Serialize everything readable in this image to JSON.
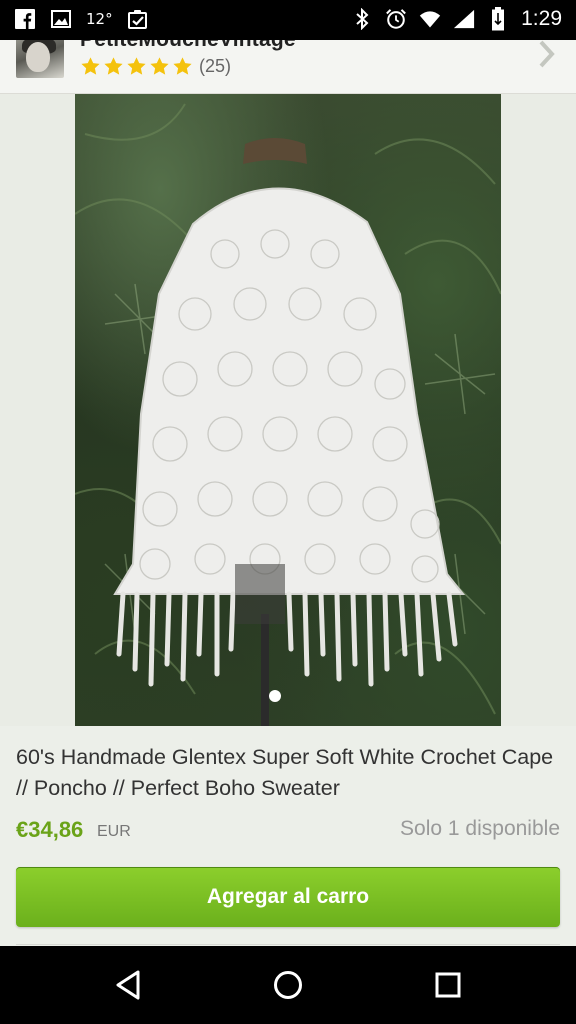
{
  "status_bar": {
    "temperature": "12°",
    "time": "1:29",
    "icons": [
      "facebook-icon",
      "image-icon",
      "checklist-icon",
      "bluetooth-icon",
      "alarm-icon",
      "wifi-icon",
      "signal-icon",
      "battery-icon"
    ]
  },
  "shop": {
    "name": "PetiteMoucheVintage",
    "rating_stars": 5,
    "review_count": "(25)"
  },
  "gallery": {
    "image_count_dots": 1,
    "active_index": 0
  },
  "listing": {
    "title": "60's Handmade Glentex Super Soft White Crochet Cape // Poncho // Perfect Boho Sweater",
    "price": "€34,86",
    "currency": "EUR",
    "availability": "Solo 1 disponible",
    "add_to_cart_label": "Agregar al carro"
  },
  "colors": {
    "accent_green": "#6aa318",
    "button_green": "#7fbf25",
    "star_yellow": "#f4c20d"
  },
  "nav": {
    "buttons": [
      "back-icon",
      "home-icon",
      "recents-icon"
    ]
  }
}
